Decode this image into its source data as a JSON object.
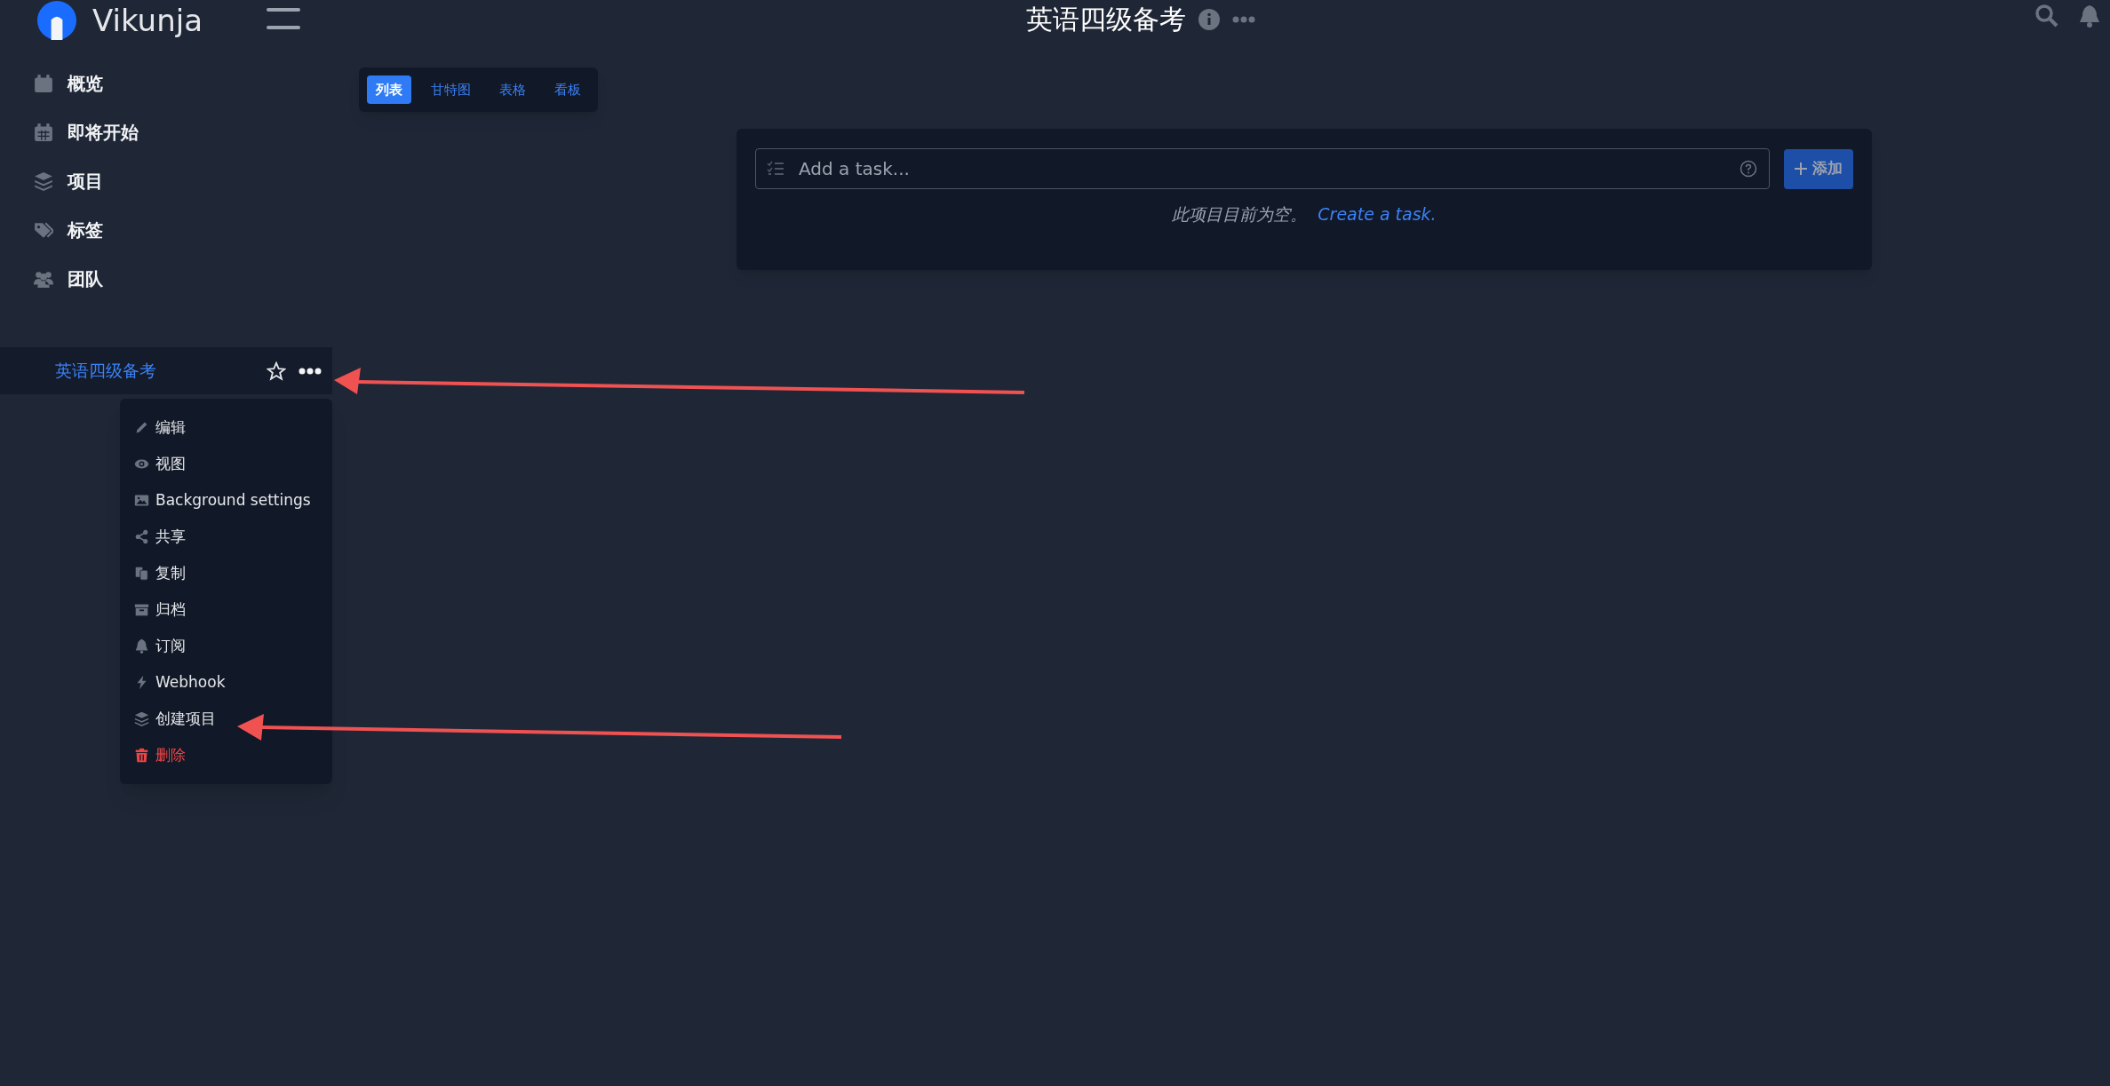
{
  "header": {
    "logo_text": "Vikunja",
    "title": "英语四级备考"
  },
  "sidebar": {
    "items": [
      {
        "label": "概览"
      },
      {
        "label": "即将开始"
      },
      {
        "label": "项目"
      },
      {
        "label": "标签"
      },
      {
        "label": "团队"
      }
    ]
  },
  "project": {
    "name": "英语四级备考",
    "favorite": false
  },
  "project_menu": [
    {
      "label": "编辑",
      "kind": "normal"
    },
    {
      "label": "视图",
      "kind": "normal"
    },
    {
      "label": "Background settings",
      "kind": "normal"
    },
    {
      "label": "共享",
      "kind": "normal"
    },
    {
      "label": "复制",
      "kind": "normal"
    },
    {
      "label": "归档",
      "kind": "normal"
    },
    {
      "label": "订阅",
      "kind": "normal"
    },
    {
      "label": "Webhook",
      "kind": "normal"
    },
    {
      "label": "创建项目",
      "kind": "normal"
    },
    {
      "label": "删除",
      "kind": "danger"
    }
  ],
  "view_tabs": [
    {
      "label": "列表",
      "selected": true
    },
    {
      "label": "甘特图",
      "selected": false
    },
    {
      "label": "表格",
      "selected": false
    },
    {
      "label": "看板",
      "selected": false
    }
  ],
  "task_input": {
    "placeholder": "Add a task..."
  },
  "add_button": {
    "label": "添加"
  },
  "empty_state": {
    "text": "此项目目前为空。",
    "link": "Create a task."
  }
}
